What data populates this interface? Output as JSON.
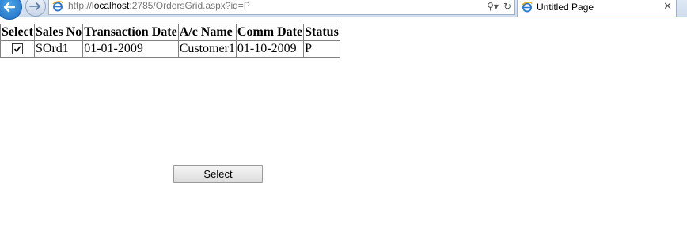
{
  "browser": {
    "url_prefix": "http://",
    "url_host": "localhost",
    "url_rest": ":2785/OrdersGrid.aspx?id=P",
    "tab_title": "Untitled Page",
    "tab_close": "✕",
    "search_glyph": "⚲▾",
    "refresh_glyph": "↻"
  },
  "grid": {
    "headers": [
      "Select",
      "Sales No",
      "Transaction Date",
      "A/c Name",
      "Comm Date",
      "Status"
    ],
    "rows": [
      {
        "checked": true,
        "sales_no": "SOrd1",
        "transaction_date": "01-01-2009",
        "ac_name": "Customer1",
        "comm_date": "01-10-2009",
        "status": "P"
      }
    ]
  },
  "select_button": {
    "label": "Select"
  }
}
